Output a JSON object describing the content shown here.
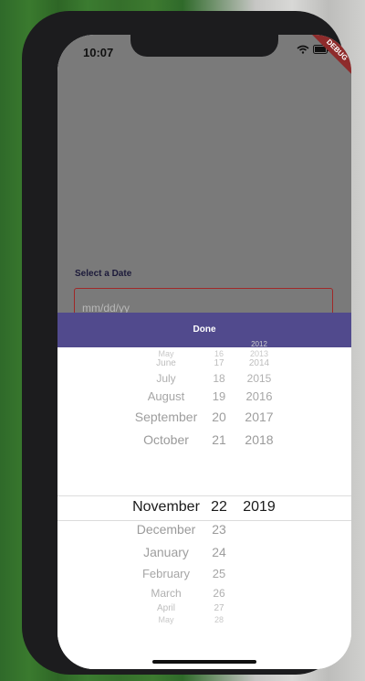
{
  "status_bar": {
    "time": "10:07",
    "debug_label": "DEBUG"
  },
  "form": {
    "label": "Select a Date",
    "placeholder": "mm/dd/yy"
  },
  "toolbar": {
    "done_label": "Done"
  },
  "picker": {
    "months": [
      "May",
      "June",
      "July",
      "August",
      "September",
      "October",
      "November",
      "December",
      "January",
      "February",
      "March",
      "April",
      "May"
    ],
    "days": [
      "16",
      "17",
      "18",
      "19",
      "20",
      "21",
      "22",
      "23",
      "24",
      "25",
      "26",
      "27",
      "28"
    ],
    "years": [
      "2012",
      "2013",
      "2014",
      "2015",
      "2016",
      "2017",
      "2018",
      "2019"
    ],
    "selected": {
      "month": "November",
      "day": "22",
      "year": "2019"
    }
  },
  "colors": {
    "accent": "#514a8d",
    "field_border": "#a02828",
    "overlay": "#7a7a7a"
  },
  "icons": [
    "wifi-icon",
    "battery-icon"
  ]
}
